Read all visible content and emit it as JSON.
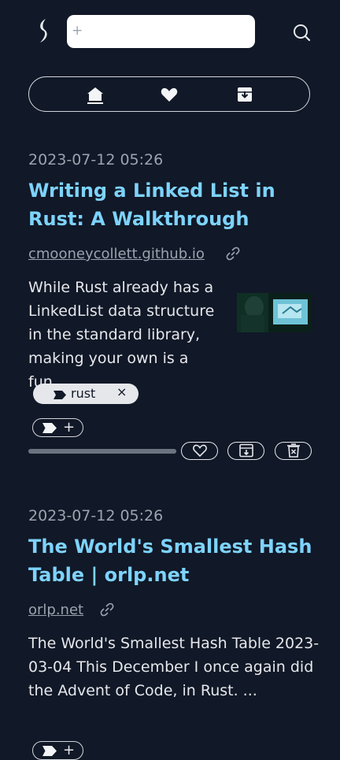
{
  "search": {
    "placeholder": "",
    "value": "",
    "plus": "+"
  },
  "nav": {
    "items": [
      "home",
      "favorites",
      "archive"
    ]
  },
  "articles": [
    {
      "date": "2023-07-12 05:26",
      "title": "Writing a Linked List in Rust: A Walkthrough",
      "domain": "cmooneycollett.github.io",
      "description": "While Rust already has a LinkedList data structure in the standard library, making your own is a fun...",
      "tags": [
        {
          "label": "rust",
          "remove": "×"
        }
      ],
      "add_tag": "+",
      "progress": 1.0
    },
    {
      "date": "2023-07-12 05:26",
      "title": "The World's Smallest Hash Table | orlp.net",
      "domain": "orlp.net",
      "description": "The World's Smallest Hash Table 2023-03-04 This December I once again did the Advent of Code, in Rust. ...",
      "add_tag": "+"
    }
  ],
  "colors": {
    "background": "#111827",
    "title": "#7dd3fc",
    "muted": "#9ca3af",
    "text": "#e5e7eb"
  }
}
